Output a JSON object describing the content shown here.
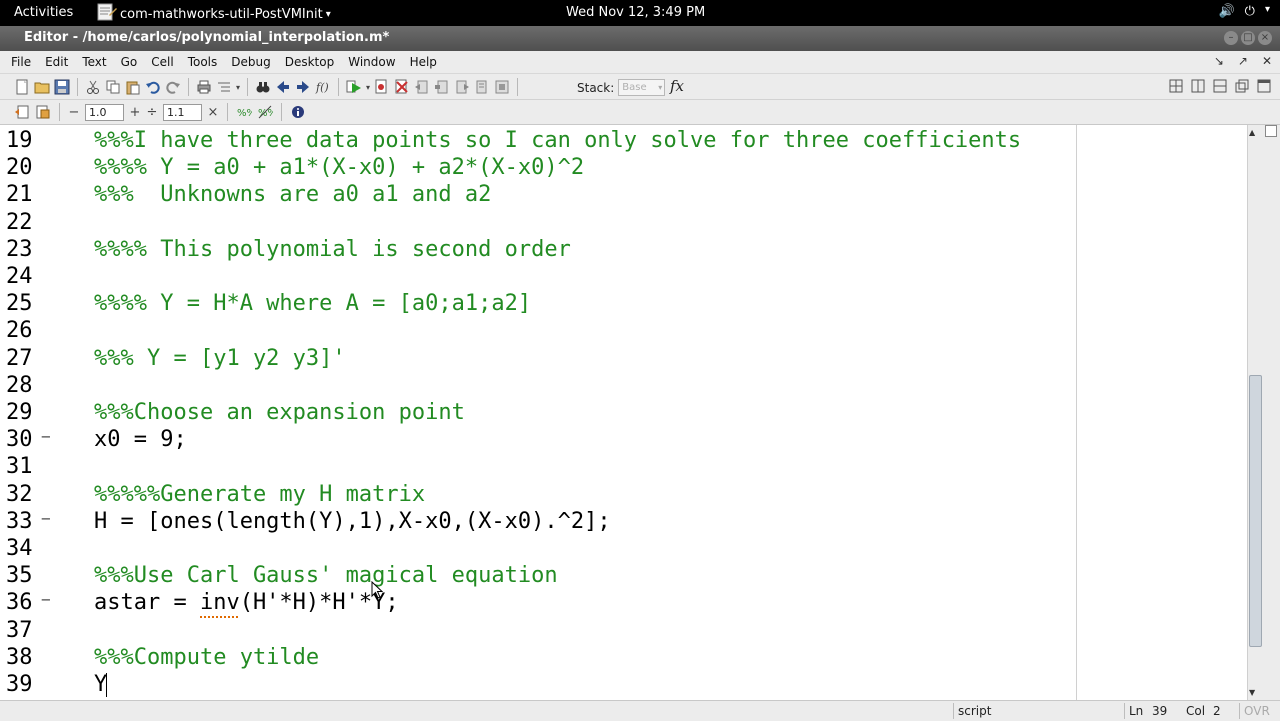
{
  "topbar": {
    "activities": "Activities",
    "app_name": "com-mathworks-util-PostVMInit",
    "app_menu_arrow": "▾",
    "clock": "Wed Nov 12,  3:49 PM",
    "volume_icon": "🔊",
    "power_icon": "⏻",
    "status_arrow": "▾"
  },
  "window": {
    "title": "Editor - /home/carlos/polynomial_interpolation.m*"
  },
  "menubar": {
    "items": [
      "File",
      "Edit",
      "Text",
      "Go",
      "Cell",
      "Tools",
      "Debug",
      "Desktop",
      "Window",
      "Help"
    ],
    "right_controls": [
      "↘",
      "↗",
      "✕"
    ]
  },
  "toolbar1": {
    "stack_label": "Stack:",
    "stack_value": "Base",
    "fx_label": "fx"
  },
  "toolbar2": {
    "minus": "−",
    "value1": "1.0",
    "plus": "+",
    "divide": "÷",
    "value2": "1.1",
    "times": "×"
  },
  "editor": {
    "lines": [
      {
        "n": "19",
        "code": "%%%I have three data points so I can only solve for three coefficients",
        "kind": "comment",
        "dash": ""
      },
      {
        "n": "20",
        "code": "%%%% Y = a0 + a1*(X-x0) + a2*(X-x0)^2",
        "kind": "comment",
        "dash": ""
      },
      {
        "n": "21",
        "code": "%%%  Unknowns are a0 a1 and a2",
        "kind": "comment",
        "dash": ""
      },
      {
        "n": "22",
        "code": "",
        "kind": "plain",
        "dash": ""
      },
      {
        "n": "23",
        "code": "%%%% This polynomial is second order",
        "kind": "comment",
        "dash": ""
      },
      {
        "n": "24",
        "code": "",
        "kind": "plain",
        "dash": ""
      },
      {
        "n": "25",
        "code": "%%%% Y = H*A where A = [a0;a1;a2]",
        "kind": "comment",
        "dash": ""
      },
      {
        "n": "26",
        "code": "",
        "kind": "plain",
        "dash": ""
      },
      {
        "n": "27",
        "code": "%%% Y = [y1 y2 y3]'",
        "kind": "comment",
        "dash": ""
      },
      {
        "n": "28",
        "code": "",
        "kind": "plain",
        "dash": ""
      },
      {
        "n": "29",
        "code": "%%%Choose an expansion point",
        "kind": "comment",
        "dash": ""
      },
      {
        "n": "30",
        "code": "x0 = 9;",
        "kind": "plain",
        "dash": "−"
      },
      {
        "n": "31",
        "code": "",
        "kind": "plain",
        "dash": ""
      },
      {
        "n": "32",
        "code": "%%%%%Generate my H matrix",
        "kind": "comment",
        "dash": ""
      },
      {
        "n": "33",
        "code": "H = [ones(length(Y),1),X-x0,(X-x0).^2];",
        "kind": "plain",
        "dash": "−"
      },
      {
        "n": "34",
        "code": "",
        "kind": "plain",
        "dash": ""
      },
      {
        "n": "35",
        "code": "%%%Use Carl Gauss' magical equation",
        "kind": "comment",
        "dash": ""
      },
      {
        "n": "36",
        "code": "astar = inv(H'*H)*H'*Y;",
        "kind": "plain",
        "dash": "−"
      },
      {
        "n": "37",
        "code": "",
        "kind": "plain",
        "dash": ""
      },
      {
        "n": "38",
        "code": "%%%Compute ytilde",
        "kind": "comment",
        "dash": ""
      },
      {
        "n": "39",
        "code": "Y",
        "kind": "plain",
        "dash": ""
      }
    ],
    "colors": {
      "comment": "#228b22",
      "code": "#000000"
    }
  },
  "statusbar": {
    "mode": "script",
    "ln_label": "Ln",
    "ln_value": "39",
    "col_label": "Col",
    "col_value": "2",
    "ovr": "OVR"
  }
}
